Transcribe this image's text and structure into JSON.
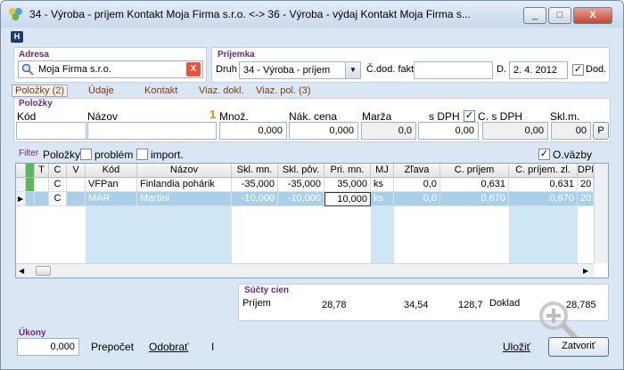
{
  "window": {
    "title": "34 - Výroba - príjem   Kontakt Moja Firma s.r.o.   <-> 36 - Výroba - výdaj   Kontakt Moja Firma s...",
    "h_label": "H",
    "minimize": "_",
    "maximize": "□",
    "close": "X"
  },
  "adresa": {
    "section": "Adresa",
    "value": "Moja Firma s.r.o.",
    "clear": "X"
  },
  "prijemka": {
    "section": "Príjemka",
    "druh_label": "Druh",
    "druh_value": "34 - Výroba - príjem",
    "cdod_label": "Č.dod. fakt.",
    "cdod_value": "",
    "d_label": "D.",
    "d_value": "2. 4. 2012",
    "dod_label": "Dod."
  },
  "tabs": [
    "Položky (2)",
    "Údaje",
    "Kontakt",
    "Viaz. dokl.",
    "Viaz. pol. (3)"
  ],
  "polozky": {
    "section": "Položky",
    "kod_label": "Kód",
    "nazov_label": "Názov",
    "mnoz_label": "Množ.",
    "mnoz_value": "0,000",
    "nak_label": "Nák. cena",
    "nak_value": "0,000",
    "marza_label": "Marža",
    "marza_value": "0,0",
    "sdph_label": "s DPH",
    "sdph_value": "0,00",
    "csdph_label": "C. s DPH",
    "csdph_value": "0,00",
    "sklm_label": "Skl.m.",
    "sklm_value": "00",
    "p_label": "P"
  },
  "filter": {
    "label": "Filter",
    "polozky": "Položky",
    "problem": "problém",
    "import": "import.",
    "ovazby": "O.väzby"
  },
  "grid": {
    "headers": [
      "T",
      "C",
      "V",
      "Kód",
      "Názov",
      "Skl. mn.",
      "Skl. pôv.",
      "Pri. mn.",
      "MJ",
      "Zľava",
      "C. príjem",
      "C. príjem. zl.",
      "DPH"
    ],
    "rows": [
      [
        "",
        "C",
        "",
        "VFPan",
        "Finlandia pohárik",
        "-35,000",
        "-35,000",
        "35,000",
        "ks",
        "0,0",
        "0,631",
        "0,631",
        "20"
      ],
      [
        "",
        "C",
        "",
        "MAR",
        "Martini",
        "-10,000",
        "-10,000",
        "10,000",
        "ks",
        "0,0",
        "0,670",
        "0,670",
        "20"
      ]
    ]
  },
  "sucty": {
    "section": "Súčty cien",
    "label": "Príjem",
    "v1": "28,78",
    "v2": "34,54",
    "v3": "128,7",
    "doklad_label": "Doklad",
    "doklad_value": "28,785"
  },
  "ukony": {
    "section": "Úkony",
    "value": "0,000",
    "prepocet": "Prepočet",
    "odobrat": "Odobrať",
    "sep": "I"
  },
  "actions": {
    "ulozit": "Uložiť",
    "zatvorit": "Zatvoriť"
  },
  "colors": {
    "accent": "#6b2a7a",
    "row_blue": "#cfe6f6",
    "orange": "#e8832a"
  }
}
